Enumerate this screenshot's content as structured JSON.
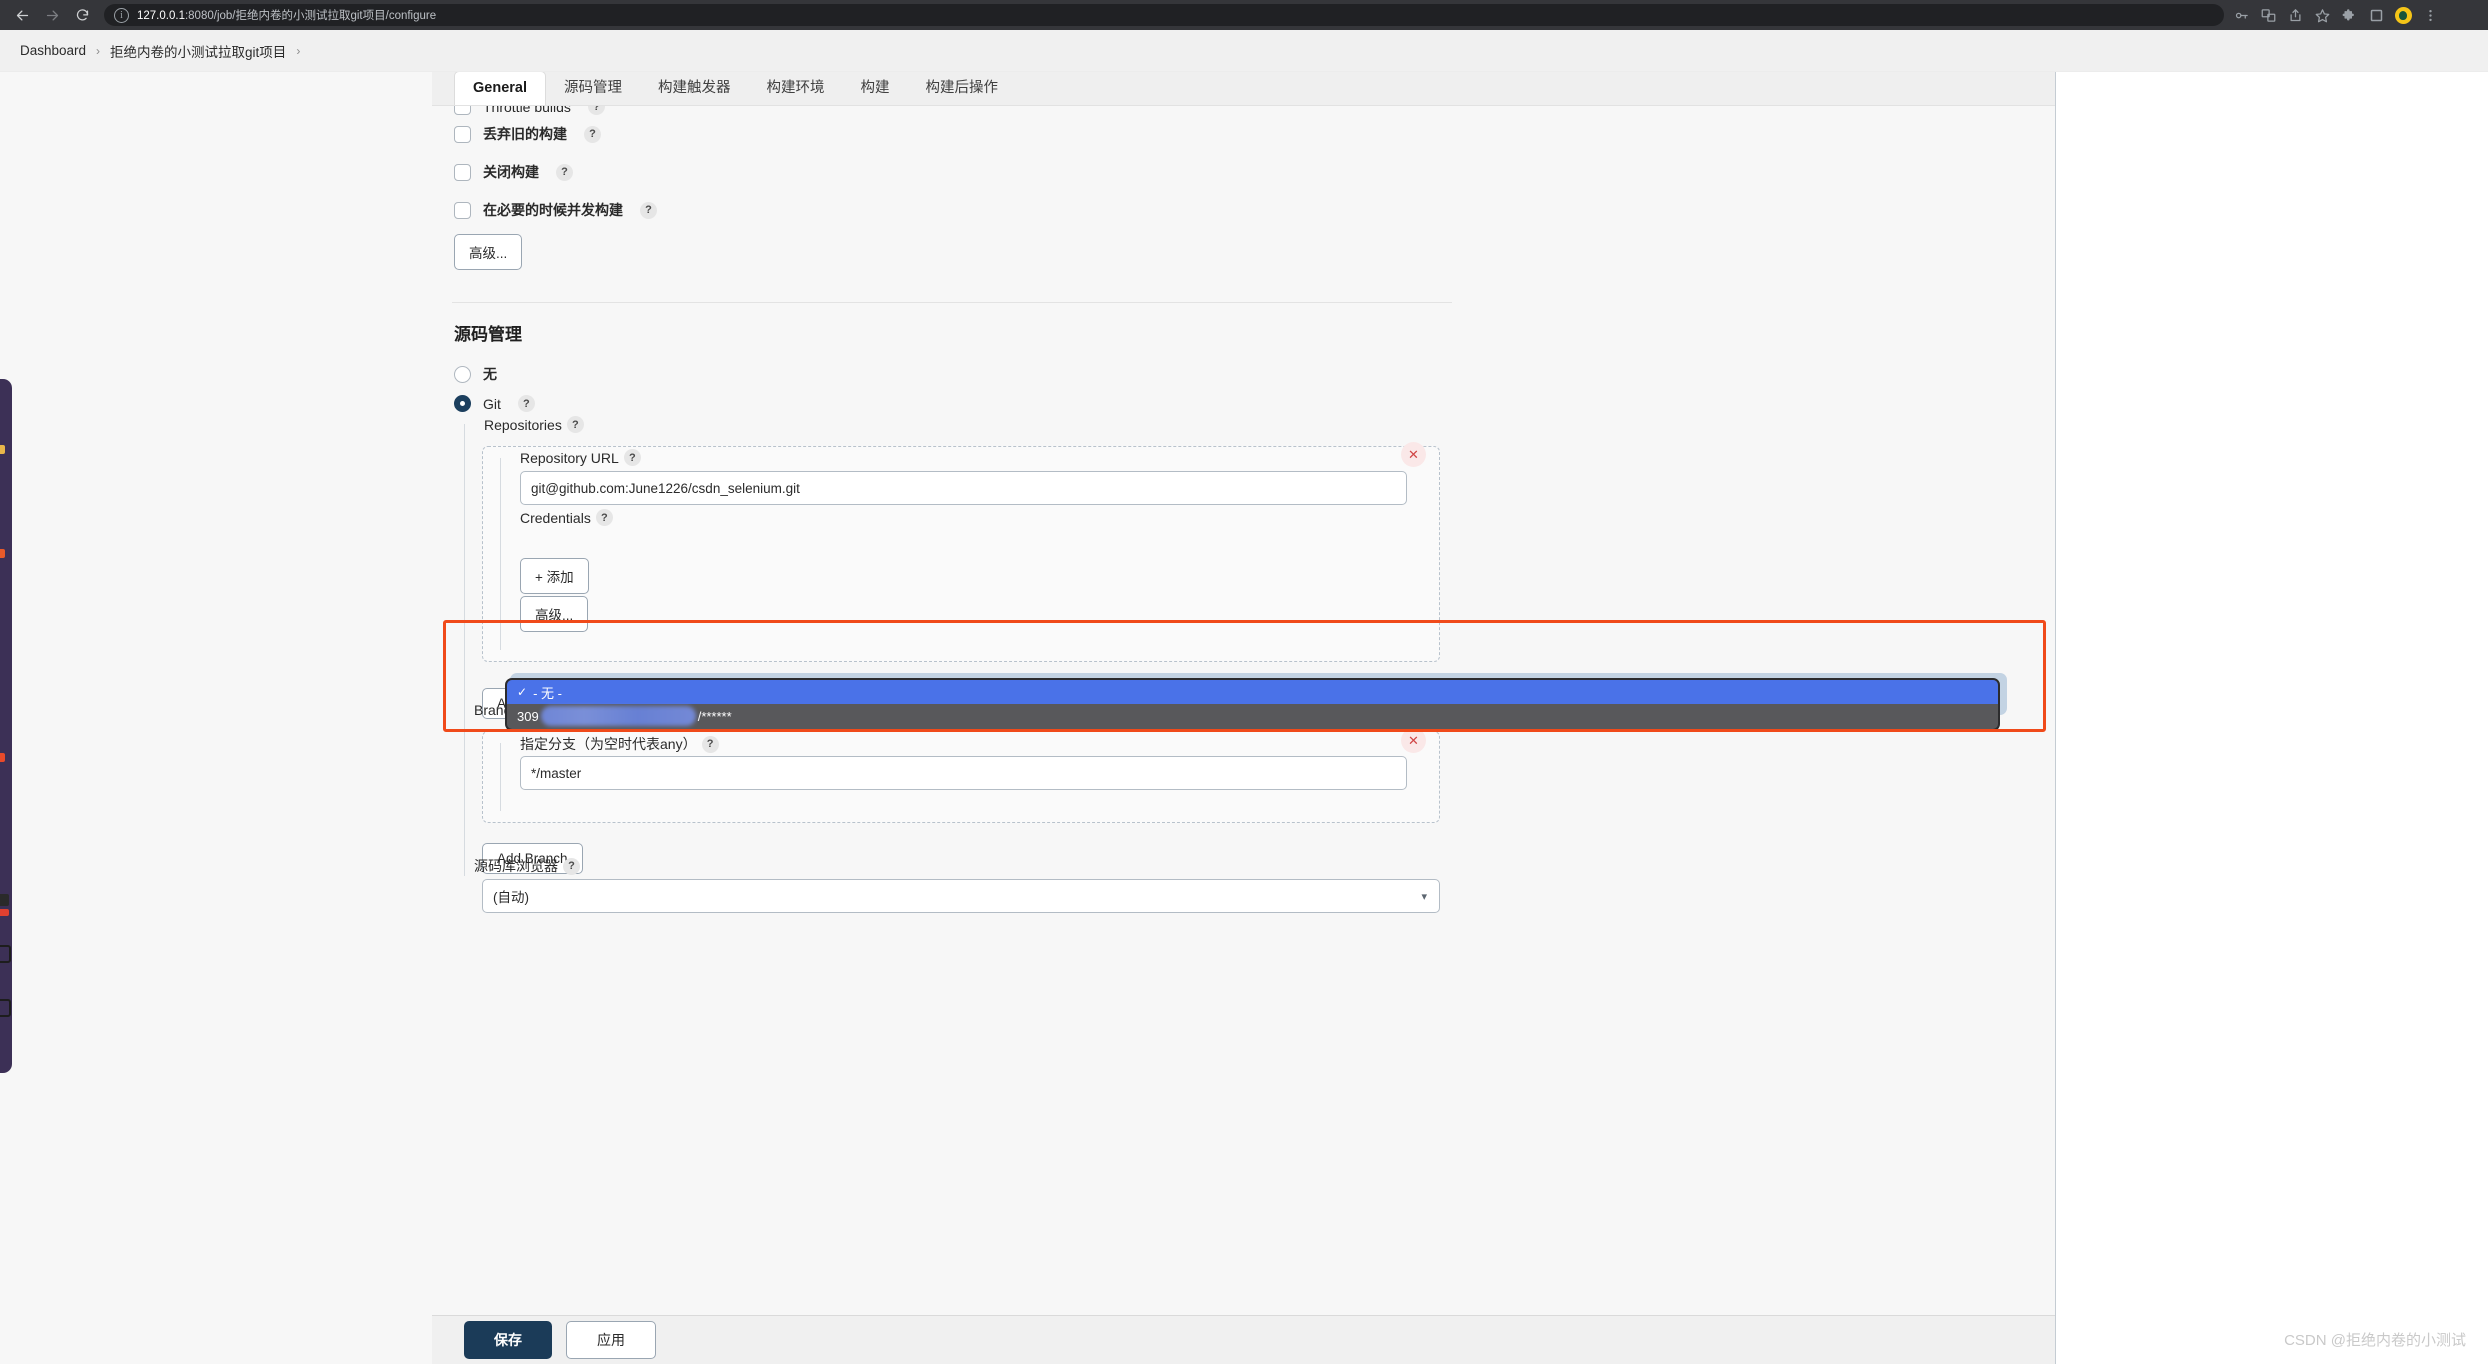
{
  "browser": {
    "back_icon": "back-arrow-icon",
    "forward_icon": "forward-arrow-icon",
    "reload_icon": "reload-icon",
    "info_icon": "site-info-icon",
    "url_host": "127.0.0.1",
    "url_rest": ":8080/job/拒绝内卷的小测试拉取git项目/configure",
    "toolbar_icons": [
      "key-icon",
      "translate-icon",
      "share-icon",
      "bookmark-star-icon",
      "extensions-puzzle-icon",
      "side-panel-icon",
      "profile-avatar-icon",
      "chrome-menu-icon"
    ]
  },
  "breadcrumb": {
    "items": [
      "Dashboard",
      "拒绝内卷的小测试拉取git项目"
    ],
    "separator": "›"
  },
  "tabs": [
    {
      "label": "General",
      "active": true
    },
    {
      "label": "源码管理",
      "active": false
    },
    {
      "label": "构建触发器",
      "active": false
    },
    {
      "label": "构建环境",
      "active": false
    },
    {
      "label": "构建",
      "active": false
    },
    {
      "label": "构建后操作",
      "active": false
    }
  ],
  "general": {
    "checkboxes": [
      {
        "label": "Throttle builds",
        "help": "?",
        "checked": false
      },
      {
        "label": "丢弃旧的构建",
        "help": "?",
        "checked": false
      },
      {
        "label": "关闭构建",
        "help": "?",
        "checked": false
      },
      {
        "label": "在必要的时候并发构建",
        "help": "?",
        "checked": false
      }
    ],
    "advanced_button": "高级..."
  },
  "scm": {
    "section_title": "源码管理",
    "radios": [
      {
        "label": "无",
        "checked": false,
        "help": null
      },
      {
        "label": "Git",
        "checked": true,
        "help": "?"
      }
    ],
    "repositories_label": "Repositories",
    "repositories_help": "?",
    "repository_url_label": "Repository URL",
    "repository_url_help": "?",
    "repository_url_value": "git@github.com:June1226/csdn_selenium.git",
    "credentials_label": "Credentials",
    "credentials_help": "?",
    "credentials_options": [
      {
        "label": "- 无 -",
        "tick": "✓",
        "selected": true
      },
      {
        "label": "309",
        "redacted": true,
        "suffix": "/******",
        "selected": false
      }
    ],
    "add_credentials_button": "+ 添加",
    "advanced_button": "高级...",
    "add_repository_button": "Add Repository",
    "delete_repo_icon": "delete-x-icon",
    "branches_label": "Branches to build",
    "branches_help": "?",
    "branch_spec_label": "指定分支（为空时代表any）",
    "branch_spec_help": "?",
    "branch_spec_value": "*/master",
    "delete_branch_icon": "delete-x-icon",
    "add_branch_button": "Add Branch",
    "repo_browser_label": "源码库浏览器",
    "repo_browser_help": "?",
    "repo_browser_value": "(自动)",
    "repo_browser_chevron": "chevron-down-icon"
  },
  "footer": {
    "save_label": "保存",
    "apply_label": "应用"
  },
  "watermark": "CSDN @拒绝内卷的小测试",
  "colors": {
    "accent_primary": "#1b3b58",
    "highlight_red": "#f04a1a",
    "dropdown_selected": "#4a72e8",
    "dropdown_bg": "#58585b",
    "dock_purple": "#3c3056"
  }
}
